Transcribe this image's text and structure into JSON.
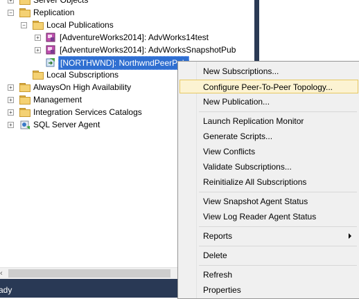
{
  "tree": {
    "server_objects": "Server Objects",
    "replication": "Replication",
    "local_publications": "Local Publications",
    "publications": [
      "[AdventureWorks2014]: AdvWorks14test",
      "[AdventureWorks2014]: AdvWorksSnapshotPub",
      "[NORTHWND]: NorthwndPeerPub"
    ],
    "local_subscriptions": "Local Subscriptions",
    "alwayson": "AlwaysOn High Availability",
    "management": "Management",
    "integration_services": "Integration Services Catalogs",
    "sql_agent": "SQL Server Agent"
  },
  "status": {
    "text": "ady"
  },
  "context_menu": {
    "items": [
      "New Subscriptions...",
      "Configure Peer-To-Peer Topology...",
      "New Publication...",
      "Launch Replication Monitor",
      "Generate Scripts...",
      "View Conflicts",
      "Validate Subscriptions...",
      "Reinitialize All Subscriptions",
      "View Snapshot Agent Status",
      "View Log Reader Agent Status",
      "Reports",
      "Delete",
      "Refresh",
      "Properties"
    ]
  },
  "colors": {
    "selection": "#2f6fd1",
    "hover": "#fcf3d2",
    "status_bar": "#293955"
  }
}
